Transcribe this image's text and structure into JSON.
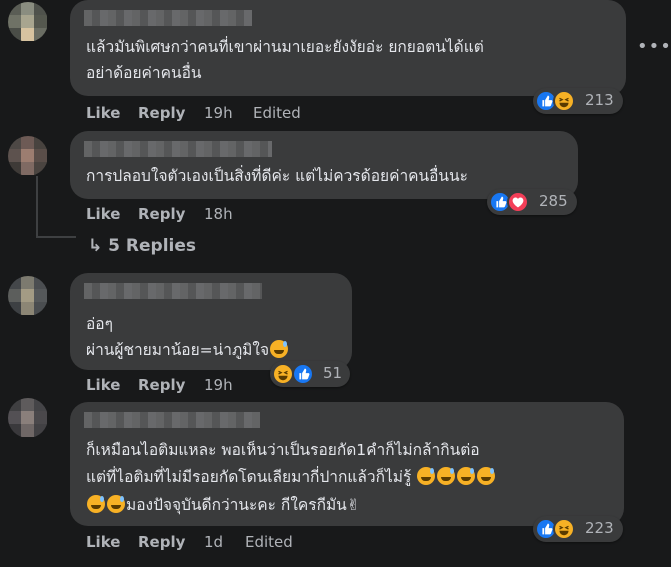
{
  "comments": [
    {
      "text_lines": [
        "แล้วมันพิเศษกว่าคนที่เขาผ่านมาเยอะยังงัยอ่ะ ยกยอตนได้แต่",
        "อย่าด้อยค่าคนอื่น"
      ],
      "like": "Like",
      "reply": "Reply",
      "time": "19h",
      "edited": "Edited",
      "reaction_count": "213",
      "reaction_icons": [
        "like-icon",
        "haha-icon"
      ]
    },
    {
      "text_lines": [
        "การปลอบใจตัวเองเป็นสิ่งที่ดีค่ะ แต่ไม่ควรด้อยค่าคนอื่นนะ"
      ],
      "like": "Like",
      "reply": "Reply",
      "time": "18h",
      "reaction_count": "285",
      "reaction_icons": [
        "like-icon",
        "love-icon"
      ],
      "replies_label": "5 Replies"
    },
    {
      "text_lines": [
        "อ่อๆ",
        "ผ่านผู้ชายมาน้อย=น่าภูมิใจ"
      ],
      "like": "Like",
      "reply": "Reply",
      "time": "19h",
      "reaction_count": "51",
      "reaction_icons": [
        "haha-icon",
        "like-icon"
      ]
    },
    {
      "text_lines": [
        "ก็เหมือนไอติมแหละ พอเห็นว่าเป็นรอยกัด1คำก็ไม่กล้ากินต่อ",
        "แต่ที่ไอติมที่ไม่มีรอยกัดโดนเลียมากี่ปากแล้วก็ไม่รู้",
        "มองปัจจุบันดีกว่านะคะ กีใครกีมัน"
      ],
      "like": "Like",
      "reply": "Reply",
      "time": "1d",
      "edited": "Edited",
      "reaction_count": "223",
      "reaction_icons": [
        "like-icon",
        "haha-icon"
      ]
    }
  ],
  "more_icon": "more-options-icon",
  "reply_arrow_icon": "reply-arrow-icon",
  "colors": {
    "background": "#18191a",
    "bubble": "#3a3b3c",
    "text": "#e4e6eb",
    "secondary": "#b0b3b8",
    "like_blue": "#1877f2",
    "haha_yellow": "#f7b125",
    "love_red": "#f33e58"
  }
}
